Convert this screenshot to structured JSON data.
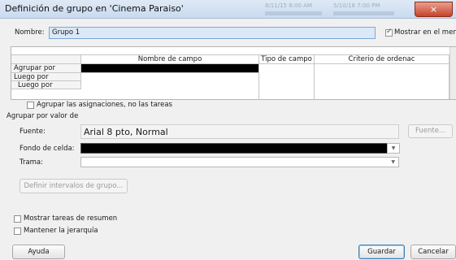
{
  "window": {
    "title": "Definición de grupo en 'Cinema Paraiso'",
    "ghost_text_1": "8/11/15 8:00 AM",
    "ghost_text_2": "5/10/18 7:00 PM",
    "close_glyph": "×"
  },
  "name_row": {
    "label": "Nombre:",
    "value": "Grupo 1",
    "show_in_menu_label": "Mostrar en el menú",
    "show_in_menu_checked": true
  },
  "grid": {
    "columns": [
      "Nombre de campo",
      "Tipo de campo",
      "Criterio de ordenac"
    ],
    "rows": [
      "Agrupar por",
      "Luego por",
      "Luego por"
    ]
  },
  "group_assignments": {
    "label": "Agrupar las asignaciones, no las tareas",
    "checked": false
  },
  "group_by_value": {
    "section_label": "Agrupar por valor de",
    "font_label": "Fuente:",
    "font_value": "Arial 8 pto, Normal",
    "font_button": "Fuente...",
    "cell_bg_label": "Fondo de celda:",
    "pattern_label": "Trama:",
    "cell_bg_color": "#000000"
  },
  "define_intervals_button": "Definir intervalos de grupo...",
  "options": {
    "summary_tasks_label": "Mostrar tareas de resumen",
    "summary_tasks_checked": false,
    "keep_hierarchy_label": "Mantener la jerarquía",
    "keep_hierarchy_checked": false
  },
  "footer": {
    "help": "Ayuda",
    "save": "Guardar",
    "cancel": "Cancelar"
  }
}
